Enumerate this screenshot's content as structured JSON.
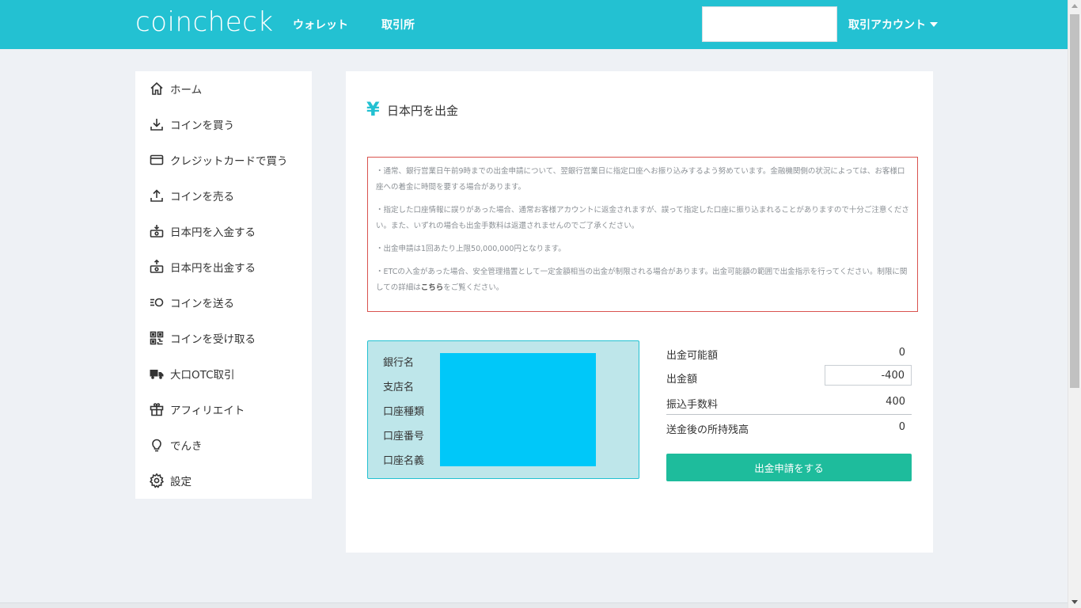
{
  "header": {
    "logo": "coincheck",
    "nav": [
      "ウォレット",
      "取引所"
    ],
    "account_label": "取引アカウント"
  },
  "sidebar": {
    "items": [
      {
        "label": "ホーム",
        "icon": "home-icon"
      },
      {
        "label": "コインを買う",
        "icon": "download-icon"
      },
      {
        "label": "クレジットカードで買う",
        "icon": "credit-card-icon"
      },
      {
        "label": "コインを売る",
        "icon": "upload-icon"
      },
      {
        "label": "日本円を入金する",
        "icon": "yen-deposit-icon"
      },
      {
        "label": "日本円を出金する",
        "icon": "yen-withdraw-icon"
      },
      {
        "label": "コインを送る",
        "icon": "send-coin-icon"
      },
      {
        "label": "コインを受け取る",
        "icon": "qr-code-icon"
      },
      {
        "label": "大口OTC取引",
        "icon": "truck-icon"
      },
      {
        "label": "アフィリエイト",
        "icon": "gift-icon"
      },
      {
        "label": "でんき",
        "icon": "lightbulb-icon"
      },
      {
        "label": "設定",
        "icon": "gear-icon"
      }
    ]
  },
  "main": {
    "title_icon": "¥",
    "title": "日本円を出金",
    "notices": [
      "・通常、銀行営業日午前9時までの出金申請について、翌銀行営業日に指定口座へお振り込みするよう努めています。金融機関側の状況によっては、お客様口座への着金に時間を要する場合があります。",
      "・指定した口座情報に誤りがあった場合、通常お客様アカウントに返金されますが、誤って指定した口座に振り込まれることがありますので十分ご注意ください。また、いずれの場合も出金手数料は返還されませんのでご了承ください。",
      "・出金申請は1回あたり上限50,000,000円となります。"
    ],
    "notice_last_before": "・ETCの入金があった場合、安全管理措置として一定金額相当の出金が制限される場合があります。出金可能額の範囲で出金指示を行ってください。制限に関しての詳細は",
    "notice_link": "こちら",
    "notice_last_after": "をご覧ください。",
    "bank_labels": [
      "銀行名",
      "支店名",
      "口座種類",
      "口座番号",
      "口座名義"
    ],
    "available_label": "出金可能額",
    "available_value": "0",
    "amount_label": "出金額",
    "amount_value": "-400",
    "fee_label": "振込手数料",
    "fee_value": "400",
    "balance_label": "送金後の所持残高",
    "balance_value": "0",
    "submit_label": "出金申請をする",
    "accent_color": "#23c1d2",
    "button_color": "#1ebc9c"
  }
}
